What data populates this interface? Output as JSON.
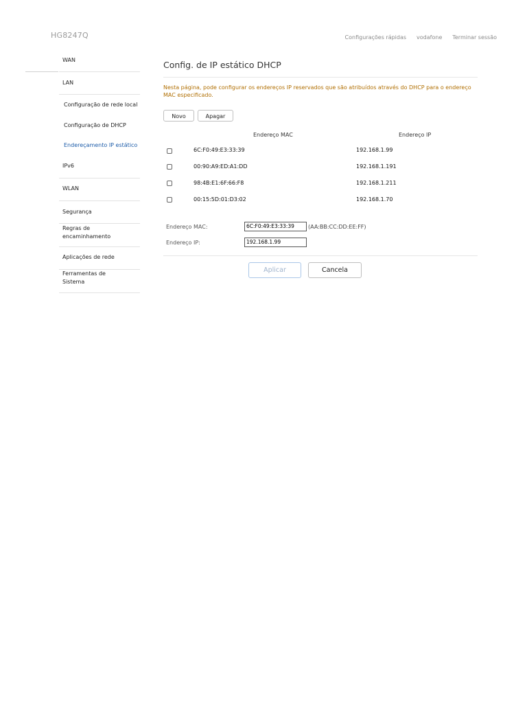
{
  "header": {
    "brand": "HG8247Q",
    "links": [
      "Configurações rápidas",
      "vodafone",
      "Terminar sessão"
    ]
  },
  "sidebar": {
    "items": [
      {
        "label": "WAN"
      },
      {
        "label": "LAN"
      },
      {
        "label": "Configuração de rede local"
      },
      {
        "label": "Configuração de DHCP"
      },
      {
        "label": "Endereçamento IP estático"
      },
      {
        "label": "IPv6"
      },
      {
        "label": "WLAN"
      },
      {
        "label": "Segurança"
      },
      {
        "label": "Regras de encaminhamento"
      },
      {
        "label": "Aplicações de rede"
      },
      {
        "label": "Ferramentas de Sistema"
      }
    ]
  },
  "main": {
    "title": "Config. de IP estático DHCP",
    "notice": "Nesta página, pode configurar os endereços IP reservados que são atribuídos através do DHCP para o endereço MAC especificado.",
    "buttons": {
      "new": "Novo",
      "delete": "Apagar"
    },
    "table": {
      "headers": [
        "Endereço MAC",
        "Endereço IP"
      ],
      "rows": [
        {
          "mac": "6C:F0:49:E3:33:39",
          "ip": "192.168.1.99"
        },
        {
          "mac": "00:90:A9:ED:A1:DD",
          "ip": "192.168.1.191"
        },
        {
          "mac": "98:4B:E1:6F:66:F8",
          "ip": "192.168.1.211"
        },
        {
          "mac": "00:15:5D:01:D3:02",
          "ip": "192.168.1.70"
        }
      ]
    },
    "form": {
      "mac_label": "Endereço MAC:",
      "mac_value": "6C:F0:49:E3:33:39",
      "mac_hint": "(AA:BB:CC:DD:EE:FF)",
      "ip_label": "Endereço IP:",
      "ip_value": "192.168.1.99"
    },
    "actions": {
      "apply": "Aplicar",
      "cancel": "Cancela"
    }
  }
}
